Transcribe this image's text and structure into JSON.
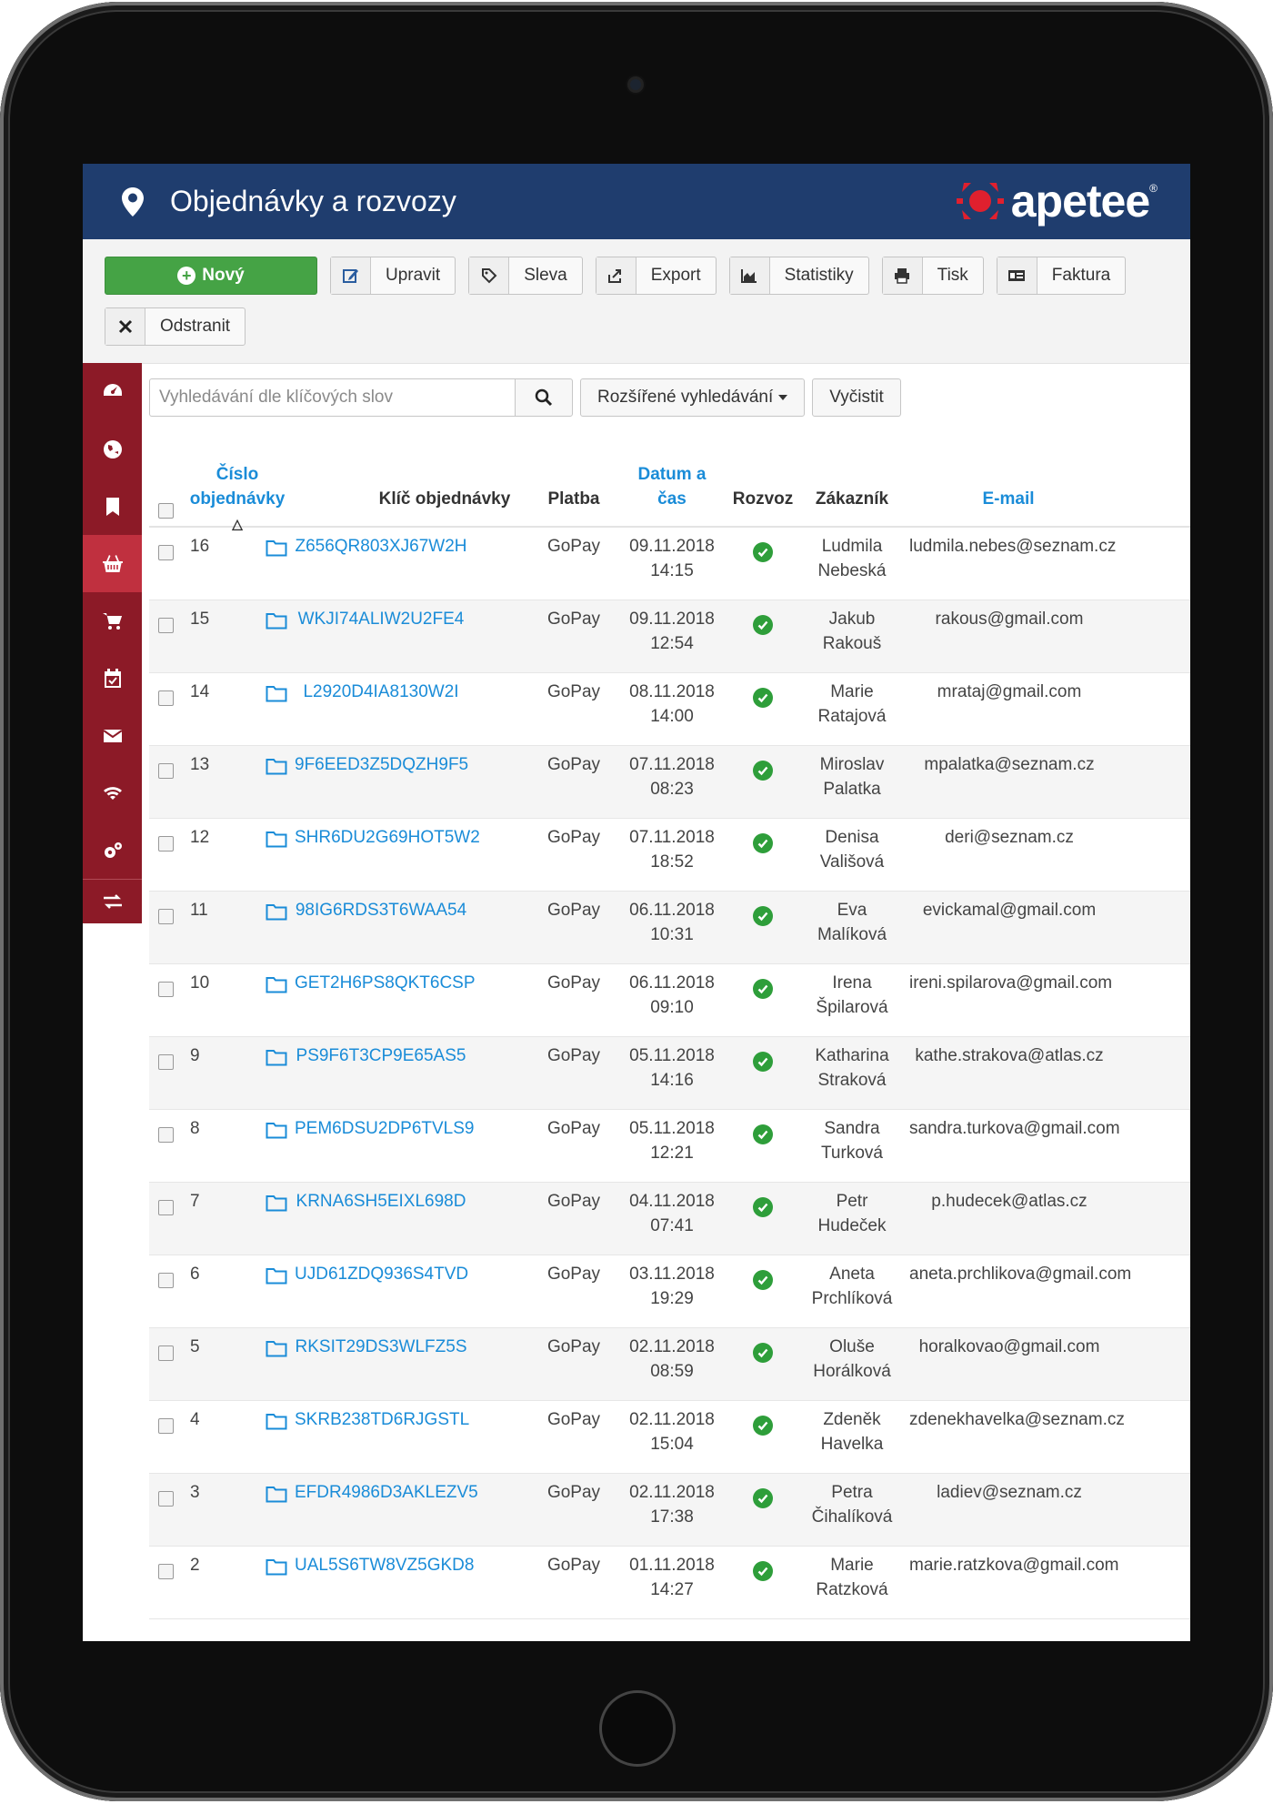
{
  "header": {
    "title": "Objednávky a rozvozy",
    "logo_text": "apetee",
    "logo_mark": "®"
  },
  "toolbar": {
    "new_label": "Nový",
    "edit_label": "Upravit",
    "discount_label": "Sleva",
    "export_label": "Export",
    "stats_label": "Statistiky",
    "print_label": "Tisk",
    "invoice_label": "Faktura",
    "delete_label": "Odstranit"
  },
  "sidebar": {
    "items": [
      {
        "icon": "dashboard-icon"
      },
      {
        "icon": "globe-icon"
      },
      {
        "icon": "bookmark-icon"
      },
      {
        "icon": "basket-icon",
        "active": true
      },
      {
        "icon": "cart-icon"
      },
      {
        "icon": "calendar-check-icon"
      },
      {
        "icon": "envelope-icon"
      },
      {
        "icon": "wifi-icon"
      },
      {
        "icon": "gears-icon"
      },
      {
        "icon": "exchange-icon"
      }
    ]
  },
  "search": {
    "placeholder": "Vyhledávání dle klíčových slov",
    "advanced_label": "Rozšířené vyhledávání",
    "clear_label": "Vyčistit"
  },
  "table": {
    "headers": {
      "number_line1": "Číslo",
      "number_line2": "objednávky",
      "sort_indicator": "△",
      "key": "Klíč objednávky",
      "payment": "Platba",
      "date_line1": "Datum a",
      "date_line2": "čas",
      "delivery": "Rozvoz",
      "customer": "Zákazník",
      "email": "E-mail"
    },
    "rows": [
      {
        "num": "16",
        "key": "Z656QR803XJ67W2H",
        "pay": "GoPay",
        "date": "09.11.2018",
        "time": "14:15",
        "first": "Ludmila",
        "last": "Nebeská",
        "email": "ludmila.nebes@seznam.cz"
      },
      {
        "num": "15",
        "key": "WKJI74ALIW2U2FE4",
        "pay": "GoPay",
        "date": "09.11.2018",
        "time": "12:54",
        "first": "Jakub",
        "last": "Rakouš",
        "email": "rakous@gmail.com"
      },
      {
        "num": "14",
        "key": "L2920D4IA8130W2I",
        "pay": "GoPay",
        "date": "08.11.2018",
        "time": "14:00",
        "first": "Marie",
        "last": "Ratajová",
        "email": "mrataj@gmail.com"
      },
      {
        "num": "13",
        "key": "9F6EED3Z5DQZH9F5",
        "pay": "GoPay",
        "date": "07.11.2018",
        "time": "08:23",
        "first": "Miroslav",
        "last": "Palatka",
        "email": "mpalatka@seznam.cz"
      },
      {
        "num": "12",
        "key": "SHR6DU2G69HOT5W2",
        "pay": "GoPay",
        "date": "07.11.2018",
        "time": "18:52",
        "first": "Denisa",
        "last": "Vališová",
        "email": "deri@seznam.cz"
      },
      {
        "num": "11",
        "key": "98IG6RDS3T6WAA54",
        "pay": "GoPay",
        "date": "06.11.2018",
        "time": "10:31",
        "first": "Eva",
        "last": "Malíková",
        "email": "evickamal@gmail.com"
      },
      {
        "num": "10",
        "key": "GET2H6PS8QKT6CSP",
        "pay": "GoPay",
        "date": "06.11.2018",
        "time": "09:10",
        "first": "Irena",
        "last": "Špilarová",
        "email": "ireni.spilarova@gmail.com"
      },
      {
        "num": "9",
        "key": "PS9F6T3CP9E65AS5",
        "pay": "GoPay",
        "date": "05.11.2018",
        "time": "14:16",
        "first": "Katharina",
        "last": "Straková",
        "email": "kathe.strakova@atlas.cz"
      },
      {
        "num": "8",
        "key": "PEM6DSU2DP6TVLS9",
        "pay": "GoPay",
        "date": "05.11.2018",
        "time": "12:21",
        "first": "Sandra",
        "last": "Turková",
        "email": "sandra.turkova@gmail.com"
      },
      {
        "num": "7",
        "key": "KRNA6SH5EIXL698D",
        "pay": "GoPay",
        "date": "04.11.2018",
        "time": "07:41",
        "first": "Petr",
        "last": "Hudeček",
        "email": "p.hudecek@atlas.cz"
      },
      {
        "num": "6",
        "key": "UJD61ZDQ936S4TVD",
        "pay": "GoPay",
        "date": "03.11.2018",
        "time": "19:29",
        "first": "Aneta",
        "last": "Prchlíková",
        "email": "aneta.prchlikova@gmail.com"
      },
      {
        "num": "5",
        "key": "RKSIT29DS3WLFZ5S",
        "pay": "GoPay",
        "date": "02.11.2018",
        "time": "08:59",
        "first": "Oluše",
        "last": "Horálková",
        "email": "horalkovao@gmail.com"
      },
      {
        "num": "4",
        "key": "SKRB238TD6RJGSTL",
        "pay": "GoPay",
        "date": "02.11.2018",
        "time": "15:04",
        "first": "Zdeněk",
        "last": "Havelka",
        "email": "zdenekhavelka@seznam.cz"
      },
      {
        "num": "3",
        "key": "EFDR4986D3AKLEZV5",
        "pay": "GoPay",
        "date": "02.11.2018",
        "time": "17:38",
        "first": "Petra",
        "last": "Čihalíková",
        "email": "ladiev@seznam.cz"
      },
      {
        "num": "2",
        "key": "UAL5S6TW8VZ5GKD8",
        "pay": "GoPay",
        "date": "01.11.2018",
        "time": "14:27",
        "first": "Marie",
        "last": "Ratzková",
        "email": "marie.ratzkova@gmail.com"
      }
    ]
  },
  "colors": {
    "header_bg": "#1f3d6e",
    "sidebar_bg": "#8c1a27",
    "sidebar_active": "#c0303f",
    "new_button": "#45a345",
    "link": "#1a8cd8",
    "delivery_ok": "#2e9e3a"
  }
}
